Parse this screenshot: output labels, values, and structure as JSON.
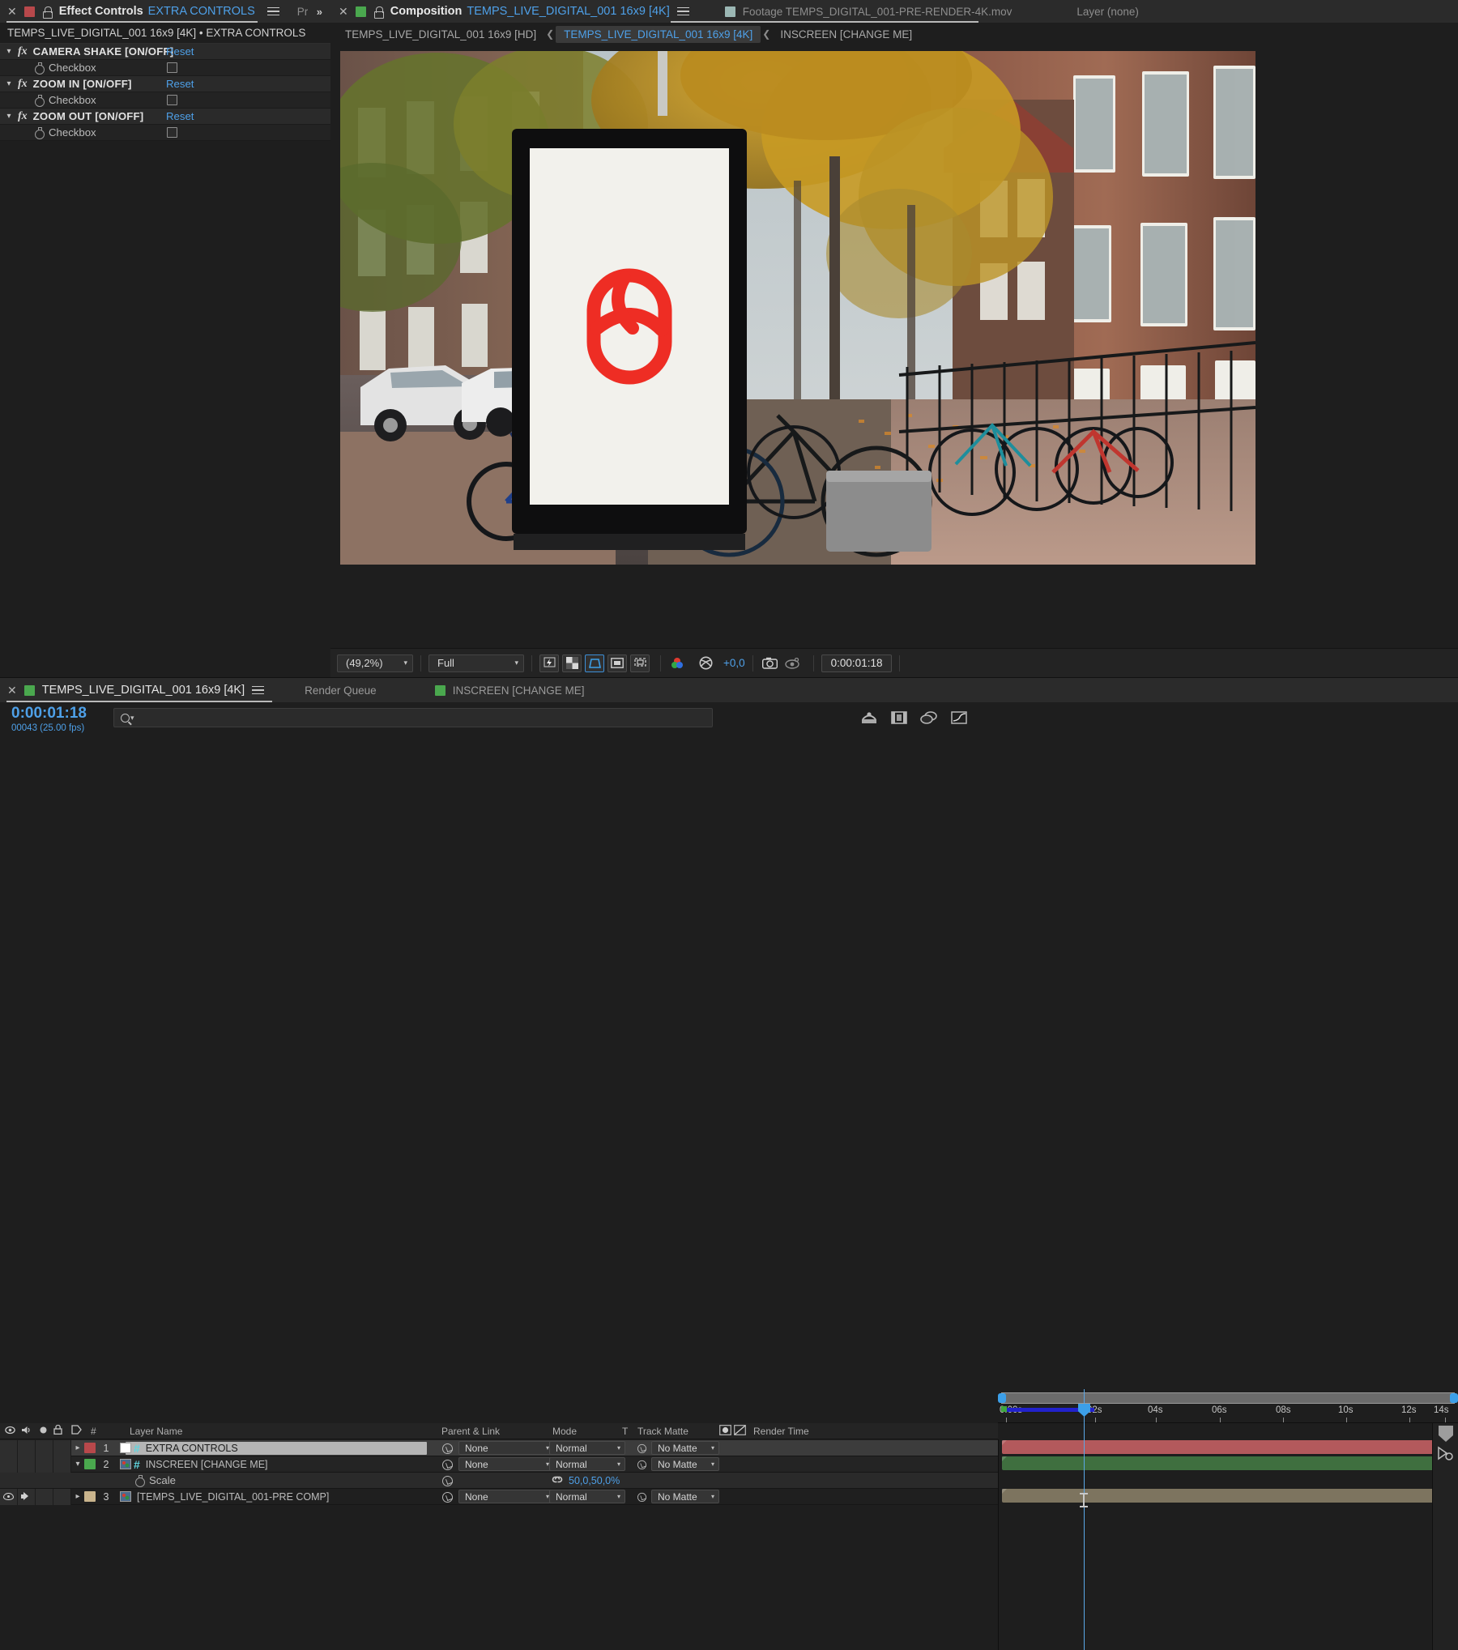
{
  "effect_controls": {
    "tab_prefix": "Effect Controls",
    "tab_target": "EXTRA CONTROLS",
    "other_tab": "Pr",
    "subtitle": "TEMPS_LIVE_DIGITAL_001 16x9 [4K] • EXTRA CONTROLS",
    "reset_label": "Reset",
    "effects": [
      {
        "name": "CAMERA SHAKE [ON/OFF]",
        "property": "Checkbox",
        "checked": false
      },
      {
        "name": "ZOOM IN [ON/OFF]",
        "property": "Checkbox",
        "checked": false
      },
      {
        "name": "ZOOM OUT [ON/OFF]",
        "property": "Checkbox",
        "checked": false
      }
    ]
  },
  "composition_panel": {
    "tab_prefix": "Composition",
    "tab_target": "TEMPS_LIVE_DIGITAL_001 16x9 [4K]",
    "footage_tab": "Footage TEMPS_DIGITAL_001-PRE-RENDER-4K.mov",
    "layer_tab": "Layer (none)",
    "breadcrumb": [
      {
        "label": "TEMPS_LIVE_DIGITAL_001 16x9 [HD]",
        "active": false
      },
      {
        "label": "TEMPS_LIVE_DIGITAL_001 16x9 [4K]",
        "active": true
      },
      {
        "label": "INSCREEN [CHANGE ME]",
        "active": false
      }
    ]
  },
  "viewer_toolbar": {
    "zoom_level": "(49,2%)",
    "resolution": "Full",
    "exposure": "+0,0",
    "timecode": "0:00:01:18",
    "icons": [
      "fast-previews-icon",
      "transparency-grid-icon",
      "region-of-interest-icon",
      "mask-shape-icon",
      "camera-view-icon",
      "channels-icon",
      "exposure-icon",
      "snapshot-icon",
      "show-snapshot-icon"
    ]
  },
  "timeline": {
    "tab_name": "TEMPS_LIVE_DIGITAL_001 16x9 [4K]",
    "render_queue_tab": "Render Queue",
    "inscreen_tab": "INSCREEN [CHANGE ME]",
    "current_time": "0:00:01:18",
    "frame_info": "00043 (25.00 fps)",
    "search_placeholder": "",
    "columns": {
      "label": "",
      "number": "#",
      "layer_name": "Layer Name",
      "parent_link": "Parent & Link",
      "mode": "Mode",
      "t": "T",
      "track_matte": "Track Matte",
      "render_time": "Render Time"
    },
    "ruler_ticks": [
      "0:00s",
      "02s",
      "04s",
      "06s",
      "08s",
      "10s",
      "12s",
      "14s"
    ],
    "layers": [
      {
        "index": "1",
        "name": "EXTRA CONTROLS",
        "color": "#b8484b",
        "bar_color": "#b3595c",
        "parent": "None",
        "mode": "Normal",
        "track_matte": "No Matte",
        "selected": true,
        "expanded": false,
        "video_on": false,
        "audio_on": false,
        "source_type": "solid"
      },
      {
        "index": "2",
        "name": "INSCREEN [CHANGE ME]",
        "color": "#4aa84e",
        "bar_color": "#3f6f3f",
        "parent": "None",
        "mode": "Normal",
        "track_matte": "No Matte",
        "selected": false,
        "expanded": true,
        "video_on": false,
        "audio_on": false,
        "source_type": "comp",
        "properties": [
          {
            "name": "Scale",
            "value": "50,0,50,0%",
            "linked": true
          }
        ]
      },
      {
        "index": "3",
        "name": "[TEMPS_LIVE_DIGITAL_001-PRE COMP]",
        "color": "#c9b48c",
        "bar_color": "#7d745f",
        "parent": "None",
        "mode": "Normal",
        "track_matte": "No Matte",
        "selected": false,
        "expanded": false,
        "video_on": true,
        "audio_on": true,
        "source_type": "comp"
      }
    ],
    "toolbar_icons": [
      "motion-blur-icon",
      "frame-blend-icon",
      "shy-icon",
      "graph-editor-icon"
    ]
  },
  "colors": {
    "accent_blue": "#4ea0e8",
    "logo_red": "#ee2d24",
    "panel_bg": "#1e1e1e",
    "tab_bg": "#2b2b2b"
  },
  "artwork": {
    "billboard_logo": "red-capsule-s-logo",
    "scene": "amsterdam-street-with-digital-billboard-bikes-autumn-trees"
  }
}
